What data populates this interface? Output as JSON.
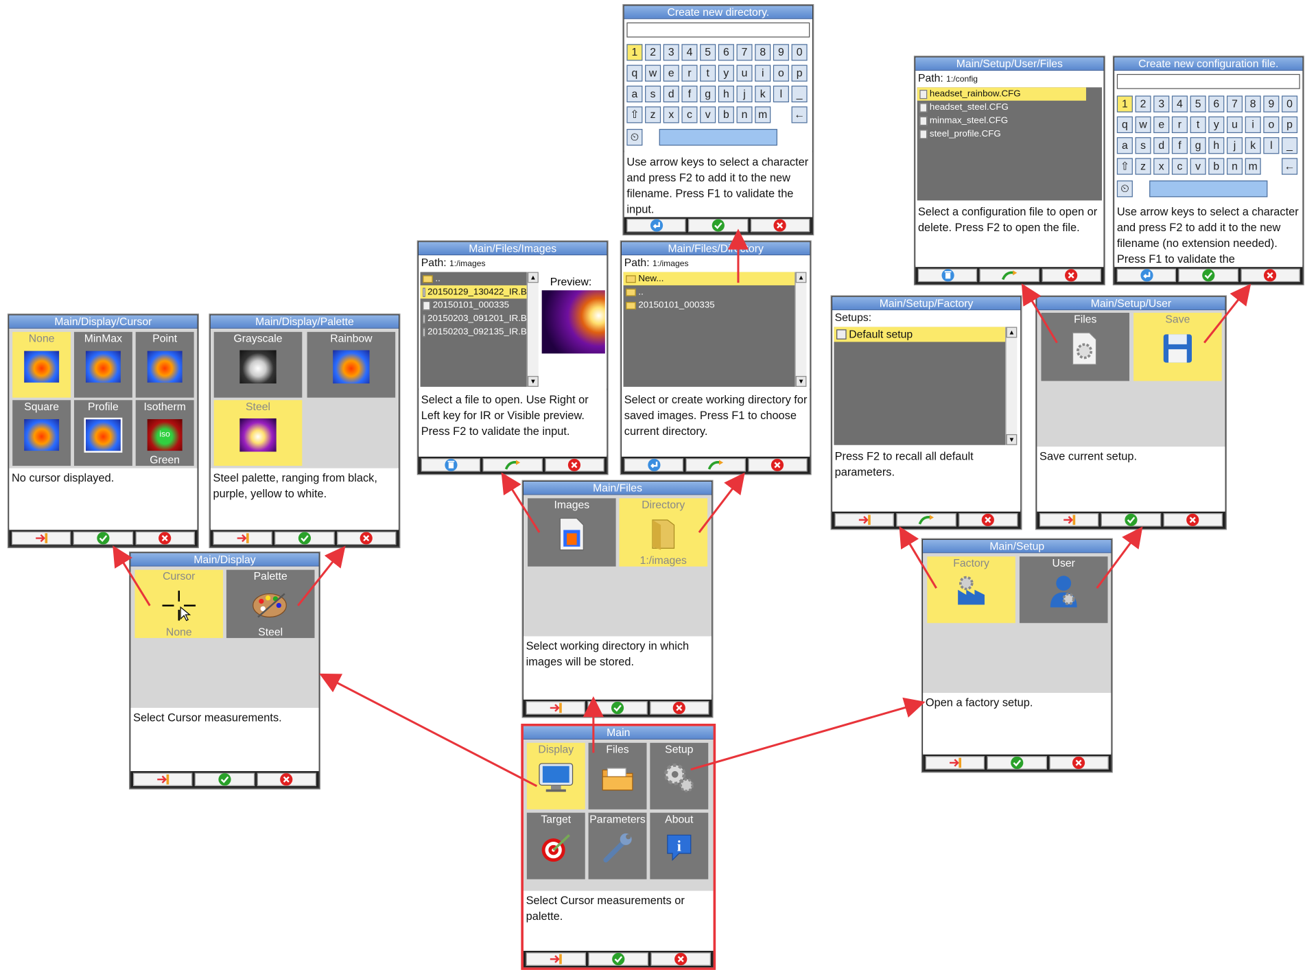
{
  "main": {
    "title": "Main",
    "tiles": [
      {
        "label": "Display",
        "icon": "monitor-icon"
      },
      {
        "label": "Files",
        "icon": "folder-icon"
      },
      {
        "label": "Setup",
        "icon": "gears-icon"
      },
      {
        "label": "Target",
        "icon": "target-icon"
      },
      {
        "label": "Parameters",
        "icon": "wrench-icon"
      },
      {
        "label": "About",
        "icon": "info-icon"
      }
    ],
    "desc": "Select Cursor measurements or palette."
  },
  "display": {
    "title": "Main/Display",
    "tiles": [
      {
        "label": "Cursor",
        "sub": "None",
        "icon": "cursor-crosshair-icon"
      },
      {
        "label": "Palette",
        "sub": "Steel",
        "icon": "palette-icon"
      }
    ],
    "desc": "Select Cursor measurements."
  },
  "cursor": {
    "title": "Main/Display/Cursor",
    "tiles": [
      {
        "label": "None"
      },
      {
        "label": "MinMax"
      },
      {
        "label": "Point"
      },
      {
        "label": "Square"
      },
      {
        "label": "Profile"
      },
      {
        "label": "Isotherm",
        "sub": "Green",
        "iso": "iso"
      }
    ],
    "desc": "No cursor displayed."
  },
  "palette": {
    "title": "Main/Display/Palette",
    "tiles": [
      {
        "label": "Grayscale"
      },
      {
        "label": "Rainbow"
      },
      {
        "label": "Steel"
      }
    ],
    "desc": "Steel palette, ranging from black, purple, yellow to white."
  },
  "files": {
    "title": "Main/Files",
    "tiles": [
      {
        "label": "Images",
        "icon": "image-file-icon"
      },
      {
        "label": "Directory",
        "sub": "1:/images",
        "icon": "folder-icon"
      }
    ],
    "desc": "Select working directory in which images will be stored."
  },
  "images": {
    "title": "Main/Files/Images",
    "path_label": "Path:",
    "path": "1:/images",
    "items": [
      "..",
      "20150129_130422_IR.B",
      "20150101_000335",
      "20150203_091201_IR.B",
      "20150203_092135_IR.B"
    ],
    "preview_label": "Preview:",
    "desc": "Select a file to open. Use Right or Left key for IR or Visible preview. Press F2 to validate the input."
  },
  "directory": {
    "title": "Main/Files/Directory",
    "path_label": "Path:",
    "path": "1:/images",
    "items": [
      "New...",
      "..",
      "20150101_000335"
    ],
    "desc": "Select or create working directory for saved images. Press F1 to choose current directory."
  },
  "newdir": {
    "title": "Create new directory.",
    "rows": [
      [
        "1",
        "2",
        "3",
        "4",
        "5",
        "6",
        "7",
        "8",
        "9",
        "0"
      ],
      [
        "q",
        "w",
        "e",
        "r",
        "t",
        "y",
        "u",
        "i",
        "o",
        "p"
      ],
      [
        "a",
        "s",
        "d",
        "f",
        "g",
        "h",
        "j",
        "k",
        "l",
        "_"
      ],
      [
        "⇧",
        "z",
        "x",
        "c",
        "v",
        "b",
        "n",
        "m",
        "←"
      ]
    ],
    "desc": "Use arrow keys to select a character and press F2 to add it to the new filename. Press F1 to validate the input."
  },
  "setup": {
    "title": "Main/Setup",
    "tiles": [
      {
        "label": "Factory",
        "icon": "factory-icon"
      },
      {
        "label": "User",
        "icon": "user-icon"
      }
    ],
    "desc": "Open a factory setup."
  },
  "factory": {
    "title": "Main/Setup/Factory",
    "setups_label": "Setups:",
    "items": [
      "Default setup"
    ],
    "desc": "Press F2 to recall all default parameters."
  },
  "user": {
    "title": "Main/Setup/User",
    "tiles": [
      {
        "label": "Files",
        "icon": "gear-file-icon"
      },
      {
        "label": "Save",
        "icon": "floppy-icon"
      }
    ],
    "desc": "Save current setup."
  },
  "userfiles": {
    "title": "Main/Setup/User/Files",
    "path_label": "Path:",
    "path": "1:/config",
    "items": [
      "headset_rainbow.CFG",
      "headset_steel.CFG",
      "minmax_steel.CFG",
      "steel_profile.CFG"
    ],
    "desc": "Select a configuration file to open or delete. Press F2 to open the file."
  },
  "newcfg": {
    "title": "Create new configuration file.",
    "rows": [
      [
        "1",
        "2",
        "3",
        "4",
        "5",
        "6",
        "7",
        "8",
        "9",
        "0"
      ],
      [
        "q",
        "w",
        "e",
        "r",
        "t",
        "y",
        "u",
        "i",
        "o",
        "p"
      ],
      [
        "a",
        "s",
        "d",
        "f",
        "g",
        "h",
        "j",
        "k",
        "l",
        "_"
      ],
      [
        "⇧",
        "z",
        "x",
        "c",
        "v",
        "b",
        "n",
        "m",
        "←"
      ]
    ],
    "desc": "Use arrow keys to select a character and press F2 to add it to the new filename (no extension needed). Press F1 to validate the"
  },
  "colors": {
    "title_bar": "#6d98d8",
    "selected": "#fbe96a",
    "tile": "#777777",
    "panel": "#d6d6d6",
    "highlight": "#e8343a"
  }
}
